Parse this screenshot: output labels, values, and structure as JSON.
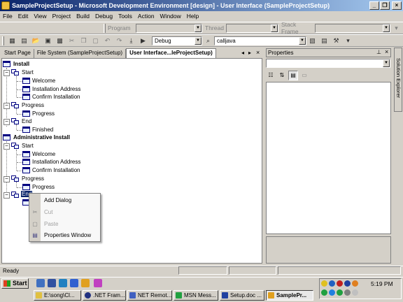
{
  "window": {
    "title": "SampleProjectSetup - Microsoft Development Environment [design] - User Interface (SampleProjectSetup)",
    "controls": {
      "minimize": "_",
      "restore": "❐",
      "close": "×"
    }
  },
  "menu": [
    "File",
    "Edit",
    "View",
    "Project",
    "Build",
    "Debug",
    "Tools",
    "Action",
    "Window",
    "Help"
  ],
  "toolbar1": {
    "program_label": "Program",
    "thread_label": "Thread",
    "stackframe_label": "Stack Frame"
  },
  "toolbar2": {
    "config_value": "Debug",
    "find_value": "calljava"
  },
  "tabs": {
    "items": [
      "Start Page",
      "File System (SampleProjectSetup)",
      "User Interface...leProjectSetup)"
    ],
    "active_index": 2,
    "nav": {
      "left": "◂",
      "right": "▸",
      "close": "×"
    }
  },
  "tree": {
    "install": {
      "label": "Install",
      "start": {
        "label": "Start",
        "children": [
          "Welcome",
          "Installation Address",
          "Confirm Installation"
        ]
      },
      "progress": {
        "label": "Progress",
        "children": [
          "Progress"
        ]
      },
      "end": {
        "label": "End",
        "children": [
          "Finished"
        ]
      }
    },
    "admin_install": {
      "label": "Administrative Install",
      "start": {
        "label": "Start",
        "children": [
          "Welcome",
          "Installation Address",
          "Confirm Installation"
        ]
      },
      "progress": {
        "label": "Progress",
        "children": [
          "Progress"
        ]
      },
      "end": {
        "label": "End"
      }
    }
  },
  "context_menu": {
    "items": [
      {
        "label": "Add Dialog",
        "enabled": true
      },
      {
        "label": "Cut",
        "enabled": false
      },
      {
        "label": "Paste",
        "enabled": false
      },
      {
        "label": "Properties Window",
        "enabled": true
      }
    ]
  },
  "properties": {
    "title": "Properties",
    "pin": "⊥",
    "close": "×"
  },
  "solution_explorer": {
    "label": "Solution Explorer"
  },
  "statusbar": {
    "text": "Ready"
  },
  "taskbar": {
    "start_label": "Start",
    "buttons": [
      {
        "label": "E:\\song\\Cl...",
        "active": false
      },
      {
        "label": ".NET Fram...",
        "active": false
      },
      {
        "label": "NET Remot...",
        "active": false
      },
      {
        "label": "MSN Mess...",
        "active": false
      },
      {
        "label": "Setup.doc ...",
        "active": false
      },
      {
        "label": "SamplePr...",
        "active": true
      }
    ],
    "clock": "5:19 PM"
  },
  "colors": {
    "titlebar_start": "#0a246a",
    "titlebar_end": "#a6caf0",
    "face": "#d4d0c8",
    "selection": "#0a246a"
  }
}
